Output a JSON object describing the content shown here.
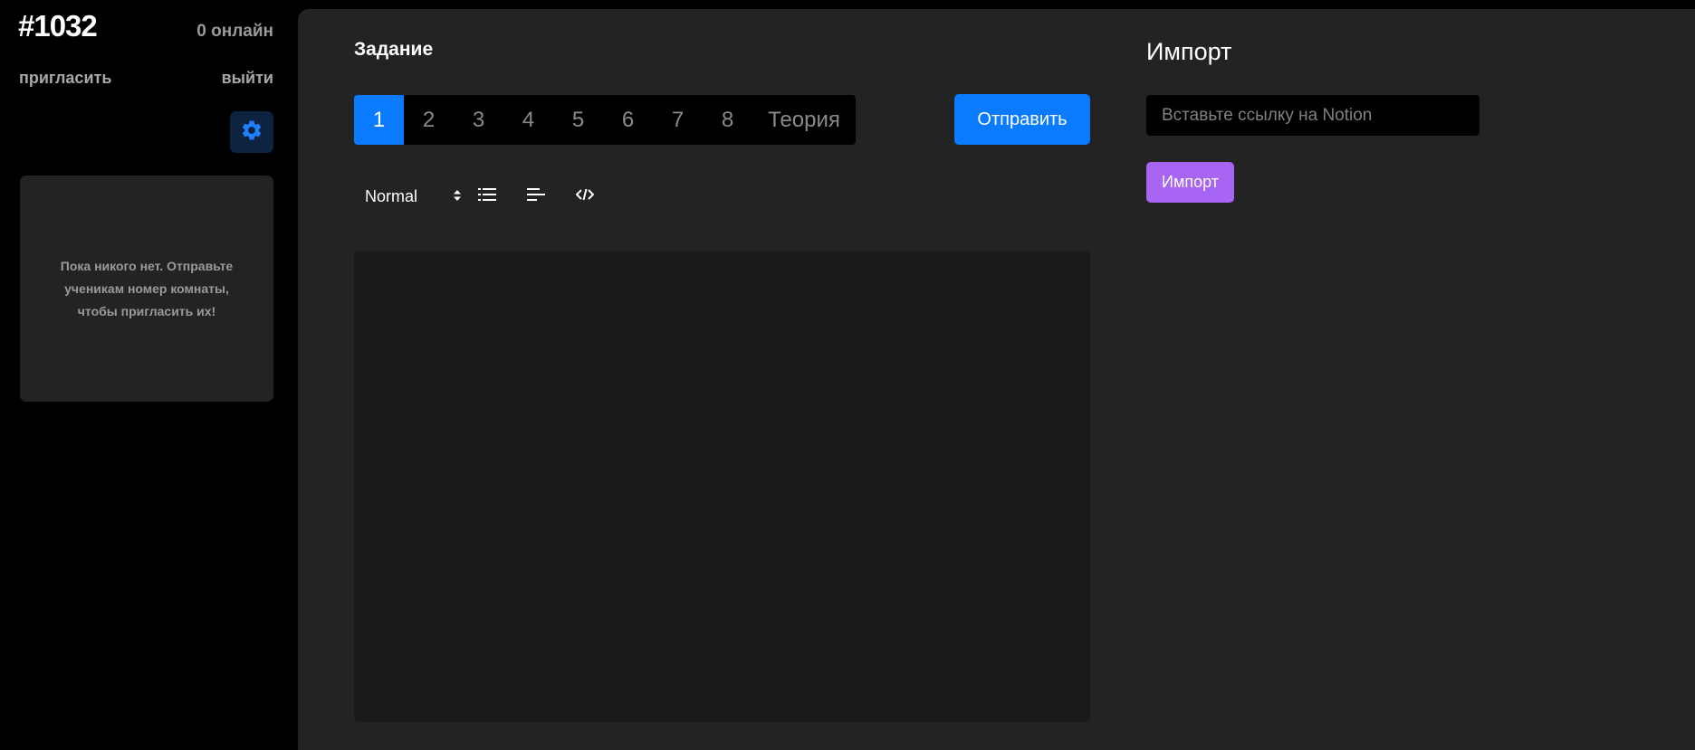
{
  "sidebar": {
    "room_id": "#1032",
    "online": "0 онлайн",
    "invite": "пригласить",
    "logout": "выйти",
    "settings_icon": "gear-icon",
    "empty_message": "Пока никого нет. Отправьте ученикам номер комнаты, чтобы пригласить их!"
  },
  "task": {
    "title": "Задание",
    "tabs": [
      "1",
      "2",
      "3",
      "4",
      "5",
      "6",
      "7",
      "8",
      "Теория"
    ],
    "active_tab": "1",
    "send_label": "Отправить"
  },
  "toolbar": {
    "format_value": "Normal",
    "icons": [
      "chevron-updown-icon",
      "bullet-list-icon",
      "align-left-icon",
      "code-icon"
    ]
  },
  "import": {
    "title": "Импорт",
    "placeholder": "Вставьте ссылку на Notion",
    "button_label": "Импорт"
  },
  "colors": {
    "accent_blue": "#0a7bff",
    "import_purple": "#a864f2",
    "panel_bg": "#232323",
    "editor_bg": "#1a1a1a"
  }
}
